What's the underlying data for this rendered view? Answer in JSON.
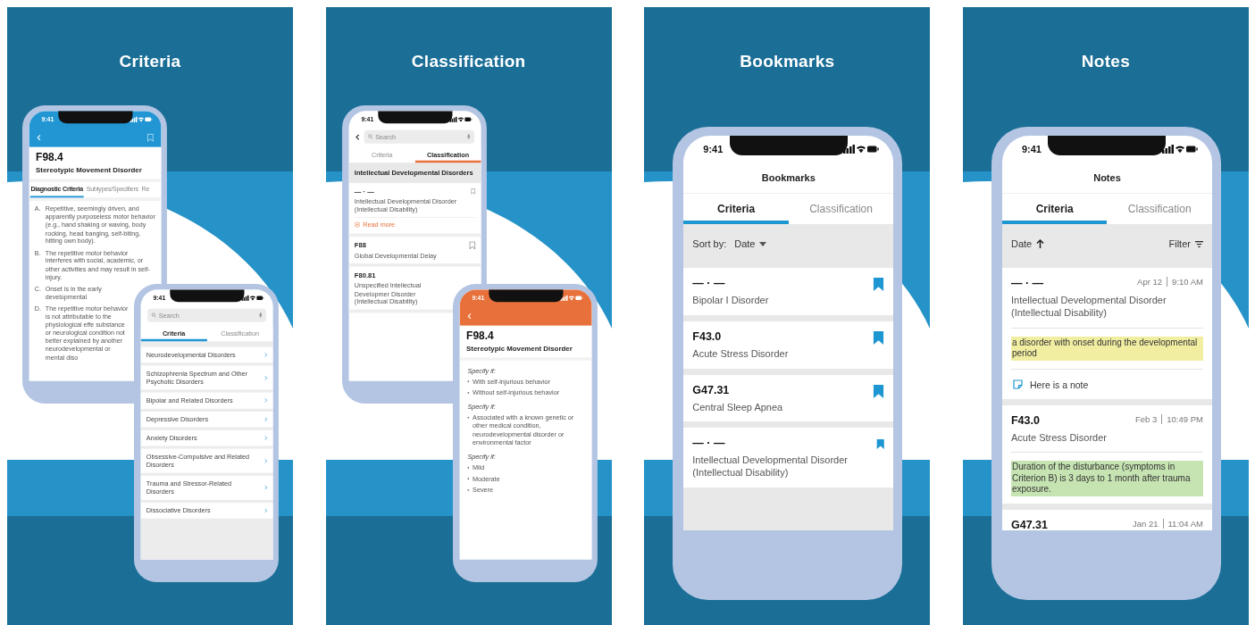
{
  "panels": [
    {
      "title": "Criteria",
      "phones": [
        {
          "kind": "detail",
          "color": "#2196d3",
          "time": "9:41",
          "code": "F98.4",
          "name": "Stereotypic Movement Disorder",
          "tabs": [
            {
              "label": "Diagnostic Criteria",
              "selected": true
            },
            {
              "label": "Subtypes/Specifiers",
              "selected": false
            },
            {
              "label": "Re",
              "selected": false
            }
          ],
          "criteria": [
            {
              "letter": "A.",
              "text": "Repetitive, seemingly driven, and apparently purposeless motor behavior (e.g., hand shaking or waving, body rocking, head banging, self-biting, hitting own body)."
            },
            {
              "letter": "B.",
              "text": "The repetitive motor behavior interferes with social, academic, or other activities and may result in self-injury."
            },
            {
              "letter": "C.",
              "text": "Onset is in the early developmental"
            },
            {
              "letter": "D.",
              "text": "The repetitive motor behavior is not attributable to the physiological effe substance or neurological condition not better explained by another neurodevelopmental or mental diso"
            }
          ]
        },
        {
          "kind": "list",
          "color": "#2196d3",
          "time": "9:41",
          "search": {
            "placeholder": "Search"
          },
          "tabs": [
            {
              "label": "Criteria",
              "selected": true
            },
            {
              "label": "Classification",
              "selected": false
            }
          ],
          "items": [
            "Neurodevelopmental Disorders",
            "Schizophrenia Spectrum and Other Psychotic Disorders",
            "Bipolar and Related Disorders",
            "Depressive Disorders",
            "Anxiety Disorders",
            "Obsessive-Compulsive and Related Disorders",
            "Trauma and Stressor-Related Disorders",
            "Dissociative Disorders"
          ]
        }
      ]
    },
    {
      "title": "Classification",
      "phones": [
        {
          "kind": "classification",
          "color": "#e8703a",
          "time": "9:41",
          "search": {
            "placeholder": "Search"
          },
          "tabs": [
            {
              "label": "Criteria",
              "selected": false
            },
            {
              "label": "Classification",
              "selected": true
            }
          ],
          "section": "Intellectual Developmental Disorders",
          "entries": [
            {
              "code": "— · —",
              "name": "Intellectual Developmental Disorder (Intellectual Disability)",
              "read_more": "Read more"
            },
            {
              "code": "F88",
              "name": "Global Developmental Delay"
            },
            {
              "code": "F80.81",
              "name": "Unspecified Intellectual Developmer Disorder (Intellectual Disability)"
            }
          ]
        },
        {
          "kind": "specifiers",
          "color": "#e8703a",
          "time": "9:41",
          "code": "F98.4",
          "name": "Stereotypic Movement Disorder",
          "groups": [
            {
              "heading": "Specify if:",
              "items": [
                "With self-injurious behavior",
                "Without self-injurious behavior"
              ]
            },
            {
              "heading": "Specify if:",
              "items": [
                "Associated with a known genetic or other medical condition, neurodevelopmental disorder or environmental factor"
              ]
            },
            {
              "heading": "Specify if:",
              "items": [
                "Mild",
                "Moderate",
                "Severe"
              ]
            }
          ]
        }
      ]
    },
    {
      "title": "Bookmarks",
      "phones": [
        {
          "kind": "bookmarks",
          "color": "#1e96d2",
          "time": "9:41",
          "title": "Bookmarks",
          "tabs": [
            {
              "label": "Criteria",
              "selected": true
            },
            {
              "label": "Classification",
              "selected": false
            }
          ],
          "sort_label": "Sort by:",
          "sort_value": "Date",
          "items": [
            {
              "code": "— · —",
              "name": "Bipolar I Disorder"
            },
            {
              "code": "F43.0",
              "name": "Acute Stress Disorder"
            },
            {
              "code": "G47.31",
              "name": "Central Sleep Apnea"
            },
            {
              "code": "— · —",
              "name": "Intellectual Developmental Disorder (Intellectual Disability)"
            }
          ]
        }
      ]
    },
    {
      "title": "Notes",
      "phones": [
        {
          "kind": "notes",
          "color": "#1e96d2",
          "time": "9:41",
          "title": "Notes",
          "tabs": [
            {
              "label": "Criteria",
              "selected": true
            },
            {
              "label": "Classification",
              "selected": false
            }
          ],
          "sort_value": "Date",
          "filter": "Filter",
          "notes": [
            {
              "code": "— · —",
              "date": "Apr 12",
              "time": "9:10 AM",
              "name": "Intellectual Developmental Disorder (Intellectual Disability)",
              "highlight": {
                "text": "a disorder with onset during the developmental period",
                "color": "#f1eea2"
              },
              "note": "Here is a note"
            },
            {
              "code": "F43.0",
              "date": "Feb 3",
              "time": "10:49 PM",
              "name": "Acute Stress Disorder",
              "highlight": {
                "text": "Duration of the disturbance (symptoms in Criterion B) is 3 days to 1 month after trauma exposure.",
                "color": "#c6e3b2"
              }
            },
            {
              "code": "G47.31",
              "date": "Jan 21",
              "time": "11:04 AM"
            }
          ]
        }
      ]
    }
  ]
}
